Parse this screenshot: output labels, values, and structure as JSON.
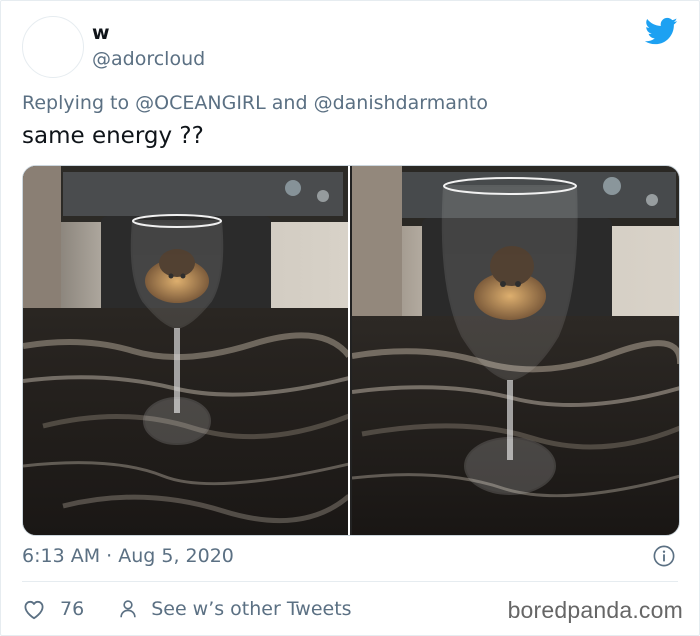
{
  "tweet": {
    "display_name": "w",
    "handle": "@adorcloud",
    "reply_prefix": "Replying to",
    "reply_user1": "@OCEANGIRL",
    "reply_and": "and",
    "reply_user2": "@danishdarmanto",
    "text": "same energy ??",
    "timestamp": "6:13 AM · Aug 5, 2020",
    "like_count": "76",
    "other_tweets_label": "See w’s other Tweets"
  },
  "watermark": "boredpanda.com",
  "colors": {
    "twitter_blue": "#1da1f2",
    "secondary_text": "#5b7083"
  },
  "icons": {
    "logo": "twitter-bird-icon",
    "info": "info-icon",
    "like": "heart-icon",
    "profile": "person-icon"
  }
}
